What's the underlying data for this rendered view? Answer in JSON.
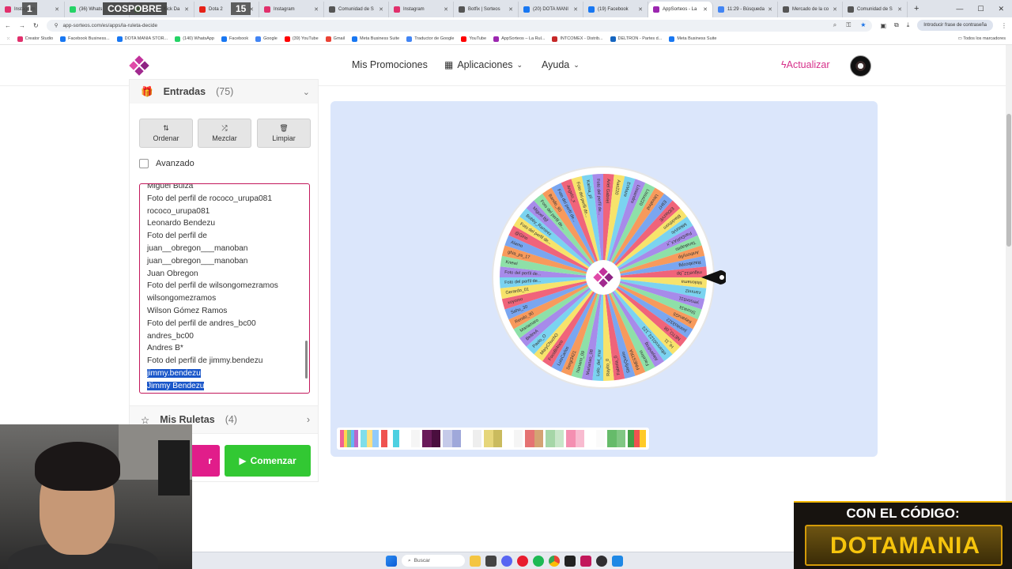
{
  "browser": {
    "tabs": [
      {
        "label": "Instagram",
        "color": "#e1306c"
      },
      {
        "label": "(36) Whats",
        "color": "#25d366"
      },
      {
        "label": "Stream - Kick Da",
        "color": "#53fc18"
      },
      {
        "label": "Dota 2",
        "color": "#e62117"
      },
      {
        "label": "Instagram",
        "color": "#e1306c"
      },
      {
        "label": "Comunidad de S",
        "color": "#555"
      },
      {
        "label": "Instagram",
        "color": "#e1306c"
      },
      {
        "label": "Botfix | Sorteos",
        "color": "#555"
      },
      {
        "label": "(20) DOTA MANI",
        "color": "#1877f2"
      },
      {
        "label": "(19) Facebook",
        "color": "#1877f2"
      },
      {
        "label": "AppSorteos - La",
        "color": "#9c27b0"
      },
      {
        "label": "11:29 - Búsqueda",
        "color": "#4285f4"
      },
      {
        "label": "Mercado de la co",
        "color": "#555"
      },
      {
        "label": "Comunidad de S",
        "color": "#555"
      }
    ],
    "overlay_left": "1",
    "overlay_title": "COSPOBRE",
    "overlay_right": "15",
    "url": "app-sorteos.com/es/apps/la-ruleta-decide",
    "password_hint": "Introducir frase de contraseña",
    "bookmarks": [
      {
        "label": "Creator Studio",
        "color": "#e1306c"
      },
      {
        "label": "Facebook Business...",
        "color": "#1877f2"
      },
      {
        "label": "DOTA MANIA STOR...",
        "color": "#1877f2"
      },
      {
        "label": "(140) WhatsApp",
        "color": "#25d366"
      },
      {
        "label": "Facebook",
        "color": "#1877f2"
      },
      {
        "label": "Google",
        "color": "#4285f4"
      },
      {
        "label": "(39) YouTube",
        "color": "#ff0000"
      },
      {
        "label": "Gmail",
        "color": "#ea4335"
      },
      {
        "label": "Meta Business Suite",
        "color": "#1877f2"
      },
      {
        "label": "Traductor de Google",
        "color": "#4285f4"
      },
      {
        "label": "YouTube",
        "color": "#ff0000"
      },
      {
        "label": "AppSorteos – La Rul...",
        "color": "#9c27b0"
      },
      {
        "label": "INTCOMEX - Distrib...",
        "color": "#c62828"
      },
      {
        "label": "DELTRON - Partes d...",
        "color": "#1565c0"
      },
      {
        "label": "Meta Business Suite",
        "color": "#1877f2"
      }
    ],
    "all_bookmarks": "Todos los marcadores"
  },
  "header": {
    "nav_promos": "Mis Promociones",
    "nav_apps": "Aplicaciones",
    "nav_help": "Ayuda",
    "upgrade": "Actualizar",
    "accent": "#d6308a"
  },
  "entries": {
    "title": "Entradas",
    "count": "(75)",
    "btn_order": "Ordenar",
    "btn_shuffle": "Mezclar",
    "btn_clear": "Limpiar",
    "advanced": "Avanzado",
    "lines": [
      "Miguel Buiza",
      "Foto del perfil de rococo_urupa081",
      "rococo_urupa081",
      "Leonardo Bendezu",
      "Foto del perfil de",
      "juan__obregon___manoban",
      "juan__obregon___manoban",
      "Juan Obregon",
      "Foto del perfil de wilsongomezramos",
      "wilsongomezramos",
      "Wilson Gómez Ramos",
      "Foto del perfil de andres_bc00",
      "andres_bc00",
      "Andres B*",
      "Foto del perfil de jimmy.bendezu"
    ],
    "selected_lines": [
      "jimmy.bendezu",
      "Jimmy Bendezu"
    ]
  },
  "my_wheels": {
    "title": "Mis Ruletas",
    "count": "(4)"
  },
  "actions": {
    "left_label": "r",
    "start_label": "Comenzar"
  },
  "wheel": {
    "labels": [
      "Ariel Gabriel",
      "Aas220",
      "ErMaze",
      "Lissandro",
      "Lissa220",
      "Uevahnd",
      "EliH7",
      "ElDiaxVE",
      "Blackthorn",
      "MikitaVic",
      "PanDoRAX_x",
      "Tanakapito",
      "Anthony5p",
      "Razabcopg",
      "miguel12_bp",
      "Molonama",
      "zammt2",
      "yerson511",
      "Shonk1k",
      "KeyaruG5",
      "juanito3322",
      "NETO_08",
      "Hi_11",
      "elbanco0123_123",
      "Alejandrog",
      "Facelino",
      "FiNESTRA",
      "StefyQuelo",
      "Fabiola_0",
      "Rayito_0",
      "Lolo_del_mar",
      "Marianao_08",
      "Nanami_09",
      "Sergi3421",
      "LuisCarlos",
      "FocoBl4nco",
      "MaryChuchO",
      "Paolo_O",
      "BeltreA",
      "Mariamaro",
      "Rendo_90",
      "Sahu_30",
      "xoyomo",
      "Gerardo_01",
      "Foto del perfil de...",
      "Foto del perfil de...",
      "Knewi",
      "ghia_ps_17",
      "Alamo",
      "@Gino",
      "Foto del perfil de...",
      "Bobby_Ramirez",
      "Miguel Bjf",
      "Foto del perfil de...",
      "Bando_90",
      "Foto del perfil de...",
      "Angelo_x",
      "Foto del perfil de...",
      "Karina_pl",
      "Foto del perfil de..."
    ],
    "segment_colors": [
      "#f0647a",
      "#f7e36b",
      "#7bd3f0",
      "#a78bea",
      "#8ee0a8",
      "#f79a5c",
      "#7aa6f0"
    ],
    "center_color": "#b0329b"
  },
  "palettes": [
    [
      "#f06292",
      "#ffd54f",
      "#81c784",
      "#64b5f6",
      "#ba68c8"
    ],
    [
      "#80deea",
      "#ffe082",
      "#90caf9"
    ],
    [
      "#ef5350",
      "#ffffff",
      "#4dd0e1"
    ],
    [
      "#ffffff",
      "#f5f5f5"
    ],
    [
      "#6a1b5a",
      "#4a0e3e"
    ],
    [
      "#c5cae9",
      "#9fa8da"
    ],
    [
      "#ffffff",
      "#eeeeee"
    ],
    [
      "#e6d67a",
      "#cabb5e"
    ],
    [
      "#ffffff",
      "#f5f5f5"
    ],
    [
      "#e57373",
      "#d4a373"
    ],
    [
      "#a5d6a7",
      "#c8e6c9"
    ],
    [
      "#f48fb1",
      "#f8bbd0"
    ],
    [
      "#ffffff",
      "#fafafa"
    ],
    [
      "#66bb6a",
      "#81c784"
    ],
    [
      "#43a047",
      "#ef5350",
      "#ffca28"
    ]
  ],
  "ad": {
    "line1": "CON EL CÓDIGO:",
    "line2": "DOTAMANIA"
  },
  "taskbar": {
    "search": "Buscar"
  }
}
